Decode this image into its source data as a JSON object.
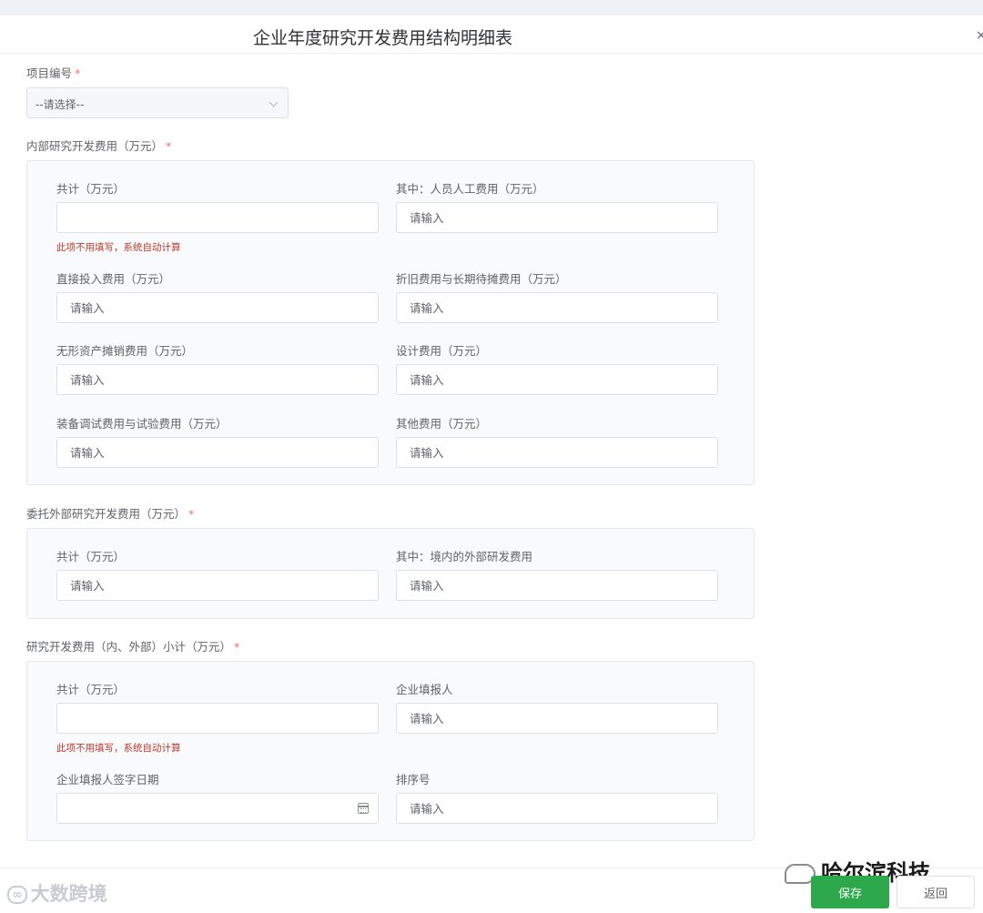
{
  "dialog": {
    "title": "企业年度研究开发费用结构明细表",
    "close_glyph": "×"
  },
  "project": {
    "label": "项目编号",
    "required": "*",
    "select_value": "--请选择--"
  },
  "internal": {
    "label": "内部研究开发费用（万元）",
    "required": "*",
    "total_label": "共计（万元）",
    "total_hint": "此项不用填写，系统自动计算",
    "personnel_label": "其中：人员人工费用（万元）",
    "direct_label": "直接投入费用（万元）",
    "depreciation_label": "折旧费用与长期待摊费用（万元）",
    "intangible_label": "无形资产摊销费用（万元）",
    "design_label": "设计费用（万元）",
    "equipment_label": "装备调试费用与试验费用（万元）",
    "other_label": "其他费用（万元）"
  },
  "external": {
    "label": "委托外部研究开发费用（万元）",
    "required": "*",
    "total_label": "共计（万元）",
    "domestic_label": "其中：境内的外部研发费用"
  },
  "subtotal": {
    "label": "研究开发费用（内、外部）小计（万元）",
    "required": "*",
    "total_label": "共计（万元）",
    "total_hint": "此项不用填写，系统自动计算",
    "reporter_label": "企业填报人",
    "sign_date_label": "企业填报人签字日期",
    "sort_label": "排序号"
  },
  "placeholders": {
    "input": "请输入"
  },
  "footer": {
    "save_label": "保存",
    "back_label": "返回"
  },
  "watermarks": {
    "left": "大数跨境",
    "right": "哈尔滨科技"
  },
  "colors": {
    "primary_green": "#2da84a",
    "required_red": "#f56c6c",
    "hint_red": "#c0392b"
  }
}
